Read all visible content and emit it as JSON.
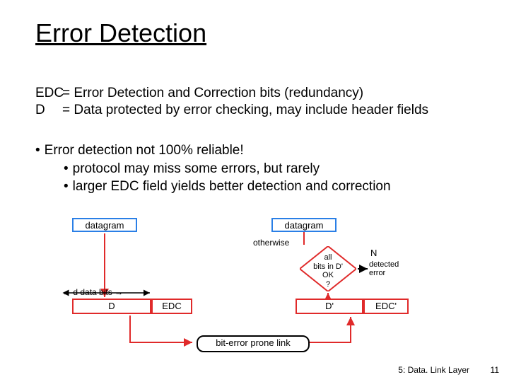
{
  "title": "Error Detection",
  "defs": {
    "edc_label": "EDC",
    "edc_text": "= Error Detection and Correction bits (redundancy)",
    "d_label": "D",
    "d_text": "= Data protected by error checking, may include header fields"
  },
  "bullets": {
    "b1": "Error detection not 100% reliable!",
    "b2": "protocol may miss some errors, but rarely",
    "b3": "larger EDC field yields better detection and correction"
  },
  "diagram": {
    "datagram": "datagram",
    "d_bits": "d data bits",
    "D": "D",
    "EDC": "EDC",
    "Dp": "D'",
    "EDCp": "EDC'",
    "decision_line1": "all",
    "decision_line2": "bits in D'",
    "decision_line3": "OK",
    "decision_line4": "?",
    "otherwise": "otherwise",
    "N": "N",
    "detected": "detected",
    "error": "error",
    "link": "bit-error prone link"
  },
  "footer": {
    "section": "5: Data. Link Layer",
    "page": "11"
  }
}
